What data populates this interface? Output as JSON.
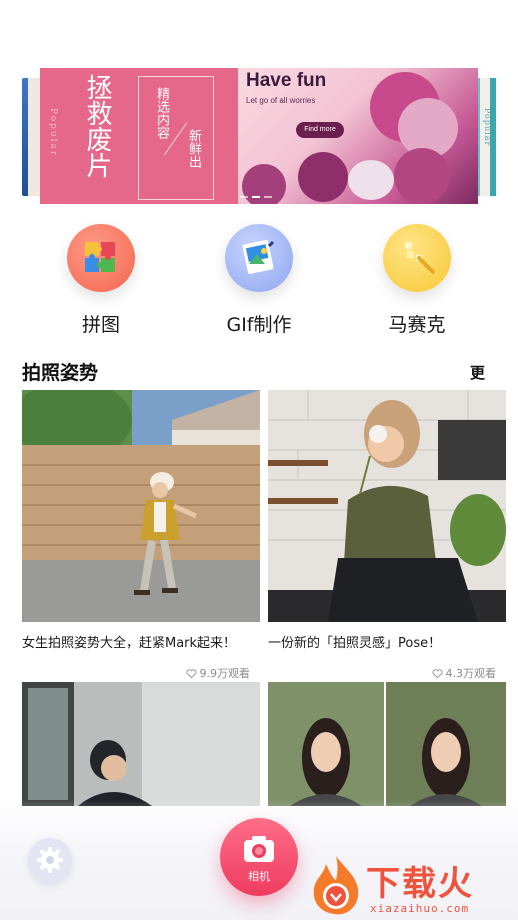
{
  "banner": {
    "left_vertical_title": "拯救废片",
    "left_popular": "Popular",
    "left_sub1": "精选内容",
    "left_sub2": "新鲜出",
    "right_title": "Have fun",
    "right_subtitle": "Let go of all worries",
    "right_button": "Find more",
    "peek_right_text": "Popular",
    "active_index": 1,
    "dot_count": 3
  },
  "tools": [
    {
      "label": "拼图",
      "icon": "puzzle-icon",
      "color": "#f57a66"
    },
    {
      "label": "GIf制作",
      "icon": "gif-image-icon",
      "color": "#9fb4f2"
    },
    {
      "label": "马赛克",
      "icon": "mosaic-brush-icon",
      "color": "#fbd34c"
    }
  ],
  "section": {
    "title": "拍照姿势",
    "more": "更"
  },
  "cards": [
    {
      "title": "女生拍照姿势大全，赶紧Mark起来！",
      "views": "9.9万观看"
    },
    {
      "title": "一份新的「拍照灵感」Pose！",
      "views": "4.3万观看"
    },
    {
      "title": "",
      "views": ""
    },
    {
      "title": "",
      "views": ""
    }
  ],
  "bottom": {
    "camera_label": "相机"
  },
  "watermark": {
    "text": "下载火",
    "url": "xiazaihuo.com"
  }
}
